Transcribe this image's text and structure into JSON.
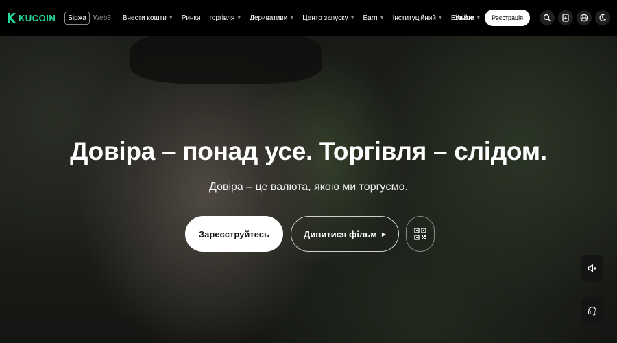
{
  "nav": {
    "logo_text": "KUCOIN",
    "mode_active": "Біржа",
    "mode_other": "Web3",
    "menu": [
      {
        "label": "Внести кошти",
        "has_caret": true
      },
      {
        "label": "Ринки",
        "has_caret": false
      },
      {
        "label": "торгівля",
        "has_caret": true
      },
      {
        "label": "Деривативи",
        "has_caret": true
      },
      {
        "label": "Центр запуску",
        "has_caret": true
      },
      {
        "label": "Earn",
        "has_caret": true
      },
      {
        "label": "Інституційний",
        "has_caret": true
      },
      {
        "label": "Більше",
        "has_caret": true
      }
    ],
    "login": "Увійти",
    "register": "Реєстрація",
    "icons": [
      "search-icon",
      "download-icon",
      "globe-icon",
      "theme-toggle-icon"
    ]
  },
  "hero": {
    "headline": "Довіра – понад усе. Торгівля – слідом.",
    "subline": "Довіра – це валюта, якою ми торгуємо.",
    "primary_cta": "Зареєструйтесь",
    "secondary_cta": "Дивитися фільм"
  },
  "colors": {
    "brand": "#23d99c",
    "nav_bg": "#000000"
  }
}
